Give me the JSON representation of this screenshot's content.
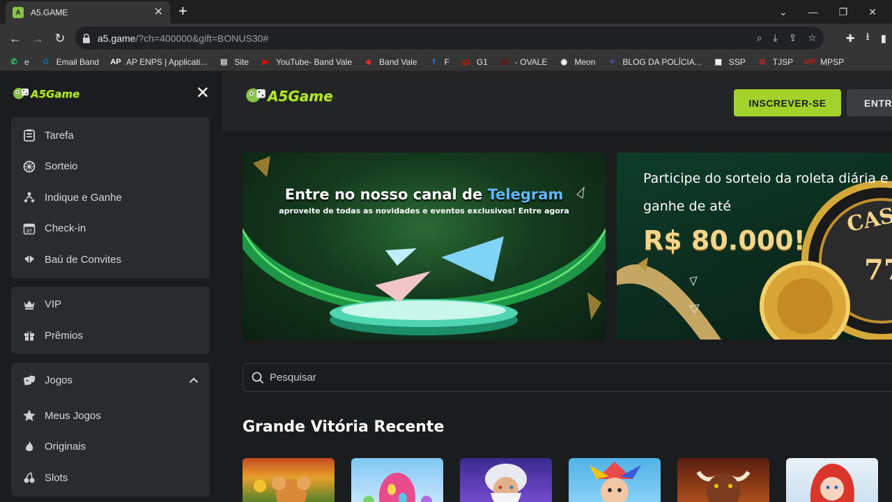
{
  "browser": {
    "tab_title": "A5.GAME",
    "favicon_letter": "A",
    "url_host": "a5.game",
    "url_rest": "/?ch=400000&gift=BONUS30#"
  },
  "bookmarks": [
    {
      "label": "e",
      "color": "#25d366",
      "glyph": "✆"
    },
    {
      "label": "Email Band",
      "color": "#0f6cbd",
      "glyph": "O"
    },
    {
      "label": "AP ENPS | Applicati...",
      "color": "#ffffff",
      "glyph": "AP"
    },
    {
      "label": "Site",
      "color": "#cfcfcf",
      "glyph": "▤"
    },
    {
      "label": "YouTube- Band Vale",
      "color": "#ff0000",
      "glyph": "▶"
    },
    {
      "label": "Band Vale",
      "color": "#d32f2f",
      "glyph": "◆"
    },
    {
      "label": "F",
      "color": "#1877f2",
      "glyph": "f"
    },
    {
      "label": "G1",
      "color": "#c4170c",
      "glyph": "g1"
    },
    {
      "label": "- OVALE",
      "color": "#8b0000",
      "glyph": "◎"
    },
    {
      "label": "Meon",
      "color": "#ffffff",
      "glyph": "◉"
    },
    {
      "label": "BLOG DA POLÍCIA...",
      "color": "#3f51b5",
      "glyph": "✦"
    },
    {
      "label": "SSP",
      "color": "#ffffff",
      "glyph": "▦"
    },
    {
      "label": "TJSP",
      "color": "#c62828",
      "glyph": "⚖"
    },
    {
      "label": "MPSP",
      "color": "#b71c1c",
      "glyph": "MP"
    }
  ],
  "sidebar": {
    "logo_text": "A5Game",
    "group1": [
      {
        "label": "Tarefa"
      },
      {
        "label": "Sorteio"
      },
      {
        "label": "Indique e Ganhe"
      },
      {
        "label": "Check-in",
        "icon_text": "07"
      },
      {
        "label": "Baú de Convites"
      }
    ],
    "group2": [
      {
        "label": "VIP"
      },
      {
        "label": "Prêmios"
      }
    ],
    "group3_header": "Jogos",
    "group3": [
      {
        "label": "Meus Jogos"
      },
      {
        "label": "Originais"
      },
      {
        "label": "Slots"
      }
    ]
  },
  "header": {
    "logo_text": "A5Game",
    "signup_label": "INSCREVER-SE",
    "login_label": "ENTRAR"
  },
  "banners": {
    "telegram": {
      "title_prefix": "Entre no nosso canal de",
      "title_highlight": "Telegram",
      "subtitle": "aproveite de todas as novidades e eventos exclusivos! Entre agora"
    },
    "roulette": {
      "line1": "Participe do sorteio da roleta diária e",
      "line2": "ganhe de até",
      "amount": "R$ 80.000!",
      "sign_text": "CASI",
      "sign_number": "77"
    }
  },
  "search": {
    "placeholder": "Pesquisar"
  },
  "section": {
    "title": "Grande Vitória Recente"
  },
  "colors": {
    "accent": "#a4d22c",
    "panel": "#2a2b2e",
    "bg": "#1b1c1e"
  }
}
